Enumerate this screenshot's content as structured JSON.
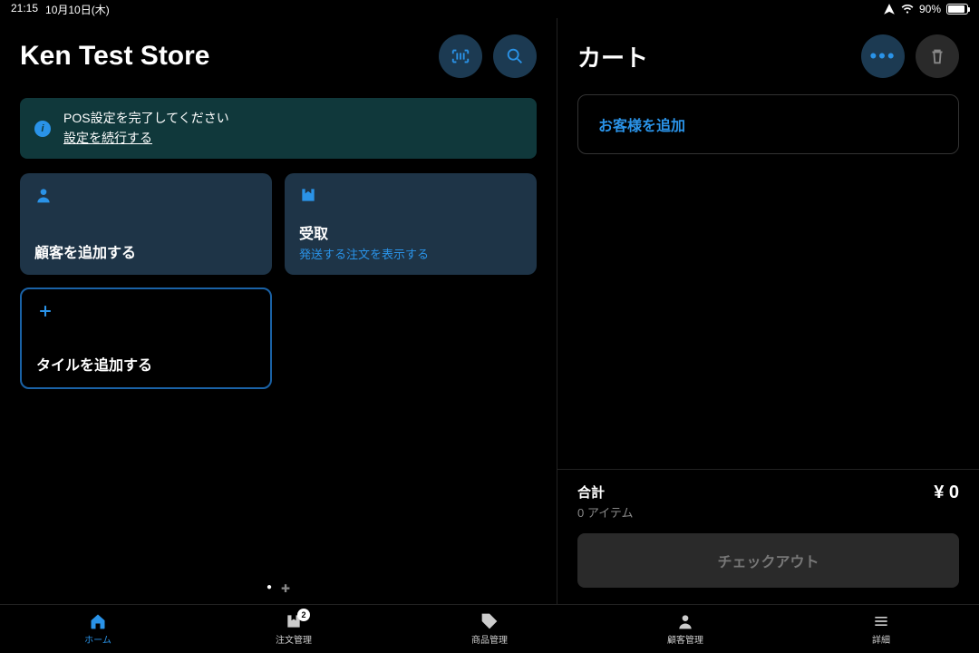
{
  "status": {
    "time": "21:15",
    "date": "10月10日(木)",
    "battery": "90%"
  },
  "left": {
    "title": "Ken Test Store",
    "alert": {
      "line1": "POS設定を完了してください",
      "link": "設定を続行する"
    },
    "tiles": {
      "add_customer": "顧客を追加する",
      "pickup_title": "受取",
      "pickup_sub": "発送する注文を表示する",
      "add_tile": "タイルを追加する"
    }
  },
  "cart": {
    "title": "カート",
    "add_customer": "お客様を追加",
    "total_label": "合計",
    "items": "0 アイテム",
    "amount": "¥ 0",
    "checkout": "チェックアウト"
  },
  "tabs": {
    "home": "ホーム",
    "orders": "注文管理",
    "orders_badge": "2",
    "products": "商品管理",
    "customers": "顧客管理",
    "more": "詳細"
  }
}
